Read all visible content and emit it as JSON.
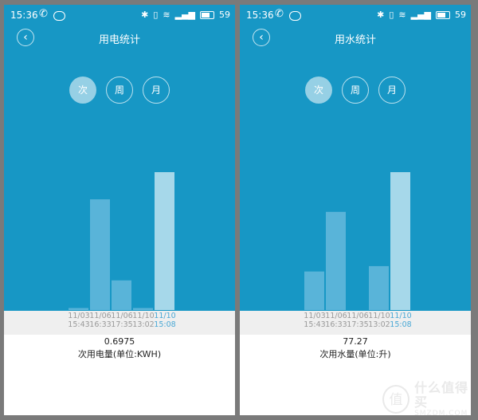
{
  "status_bar": {
    "time": "15:36",
    "battery": "59"
  },
  "colors": {
    "top_bg": "#1797c5",
    "bar": "#59b4d9",
    "bar_active": "#a6d8ea"
  },
  "periods": [
    "次",
    "周",
    "月"
  ],
  "screens": [
    {
      "title": "用电统计",
      "value": "0.6975",
      "unit": "次用电量(单位:KWH)",
      "dates": [
        {
          "date": "11/03",
          "time": "15:43"
        },
        {
          "date": "11/06",
          "time": "16:33"
        },
        {
          "date": "11/06",
          "time": "17:35"
        },
        {
          "date": "11/10",
          "time": "13:02"
        },
        {
          "date": "11/10",
          "time": "15:08"
        }
      ],
      "chart_data": {
        "type": "bar",
        "categories": [
          "11/03 15:43",
          "11/06 16:33",
          "11/06 17:35",
          "11/10 13:02",
          "11/10 15:08"
        ],
        "values": [
          0.01,
          0.56,
          0.15,
          0.01,
          0.6975
        ],
        "ylim": [
          0,
          1
        ],
        "selected_index": 4
      }
    },
    {
      "title": "用水统计",
      "value": "77.27",
      "unit": "次用水量(单位:升)",
      "dates": [
        {
          "date": "11/03",
          "time": "15:43"
        },
        {
          "date": "11/06",
          "time": "16:33"
        },
        {
          "date": "11/06",
          "time": "17:35"
        },
        {
          "date": "11/10",
          "time": "13:02"
        },
        {
          "date": "11/10",
          "time": "15:08"
        }
      ],
      "chart_data": {
        "type": "bar",
        "categories": [
          "11/03 15:43",
          "11/06 16:33",
          "11/06 17:35",
          "11/10 13:02",
          "11/10 15:08"
        ],
        "values": [
          21.6,
          55.0,
          null,
          24.6,
          77.27
        ],
        "ylim": [
          0,
          111
        ],
        "selected_index": 4
      }
    }
  ],
  "watermark": {
    "logo_char": "值",
    "brand": "什么值得买",
    "site": "SMZDM.COM"
  }
}
